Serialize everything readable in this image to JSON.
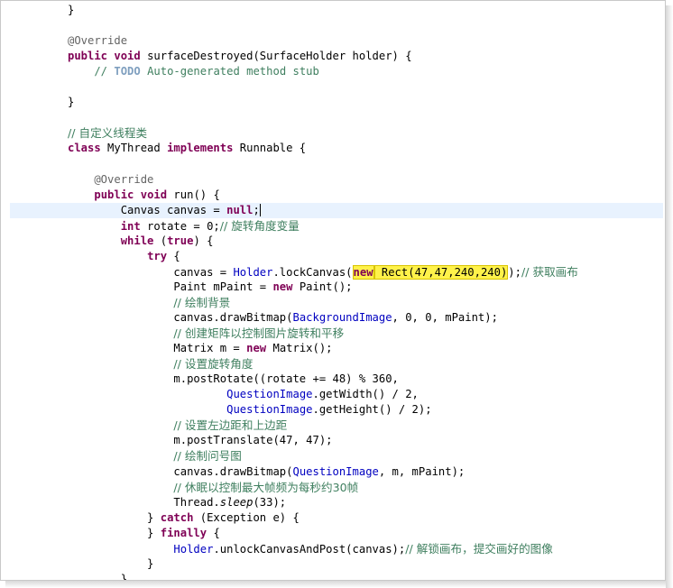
{
  "editor": {
    "current_line": 13,
    "lines": [
      [
        {
          "t": "}"
        }
      ],
      [],
      [
        {
          "t": "@Override",
          "c": "ann"
        }
      ],
      [
        {
          "t": "public",
          "c": "kw"
        },
        {
          "t": " "
        },
        {
          "t": "void",
          "c": "kw"
        },
        {
          "t": " surfaceDestroyed(SurfaceHolder holder) {"
        }
      ],
      [
        {
          "t": "    // ",
          "c": "cm-mono"
        },
        {
          "t": "TODO",
          "c": "todo"
        },
        {
          "t": " Auto-generated method stub",
          "c": "cm-mono"
        }
      ],
      [],
      [
        {
          "t": "}"
        }
      ],
      [],
      [
        {
          "t": "// 自定义线程类",
          "c": "cm"
        }
      ],
      [
        {
          "t": "class",
          "c": "kw"
        },
        {
          "t": " MyThread "
        },
        {
          "t": "implements",
          "c": "kw"
        },
        {
          "t": " Runnable {"
        }
      ],
      [],
      [
        {
          "t": "    @Override",
          "c": "ann"
        }
      ],
      [
        {
          "t": "    "
        },
        {
          "t": "public",
          "c": "kw"
        },
        {
          "t": " "
        },
        {
          "t": "void",
          "c": "kw"
        },
        {
          "t": " run() {"
        }
      ],
      [
        {
          "t": "        Canvas canvas = "
        },
        {
          "t": "null",
          "c": "kw"
        },
        {
          "t": ";"
        },
        {
          "caret": true
        }
      ],
      [
        {
          "t": "        "
        },
        {
          "t": "int",
          "c": "kw"
        },
        {
          "t": " rotate = 0;"
        },
        {
          "t": "// 旋转角度变量",
          "c": "cm"
        }
      ],
      [
        {
          "t": "        "
        },
        {
          "t": "while",
          "c": "kw"
        },
        {
          "t": " ("
        },
        {
          "t": "true",
          "c": "kw"
        },
        {
          "t": ") {"
        }
      ],
      [
        {
          "t": "            "
        },
        {
          "t": "try",
          "c": "kw"
        },
        {
          "t": " {"
        }
      ],
      [
        {
          "t": "                canvas = "
        },
        {
          "t": "Holder",
          "c": "fld"
        },
        {
          "t": ".lockCanvas("
        },
        {
          "t": "new",
          "c": "kw",
          "hl": true
        },
        {
          "t": " Rect(47,47,240,240)",
          "hl": true
        },
        {
          "t": ");"
        },
        {
          "t": "// 获取画布",
          "c": "cm"
        }
      ],
      [
        {
          "t": "                Paint mPaint = "
        },
        {
          "t": "new",
          "c": "kw"
        },
        {
          "t": " Paint();"
        }
      ],
      [
        {
          "t": "                "
        },
        {
          "t": "// 绘制背景",
          "c": "cm"
        }
      ],
      [
        {
          "t": "                canvas.drawBitmap("
        },
        {
          "t": "BackgroundImage",
          "c": "fld"
        },
        {
          "t": ", 0, 0, mPaint);"
        }
      ],
      [
        {
          "t": "                "
        },
        {
          "t": "// 创建矩阵以控制图片旋转和平移",
          "c": "cm"
        }
      ],
      [
        {
          "t": "                Matrix m = "
        },
        {
          "t": "new",
          "c": "kw"
        },
        {
          "t": " Matrix();"
        }
      ],
      [
        {
          "t": "                "
        },
        {
          "t": "// 设置旋转角度",
          "c": "cm"
        }
      ],
      [
        {
          "t": "                m.postRotate((rotate += 48) % 360,"
        }
      ],
      [
        {
          "t": "                        "
        },
        {
          "t": "QuestionImage",
          "c": "fld"
        },
        {
          "t": ".getWidth() / 2,"
        }
      ],
      [
        {
          "t": "                        "
        },
        {
          "t": "QuestionImage",
          "c": "fld"
        },
        {
          "t": ".getHeight() / 2);"
        }
      ],
      [
        {
          "t": "                "
        },
        {
          "t": "// 设置左边距和上边距",
          "c": "cm"
        }
      ],
      [
        {
          "t": "                m.postTranslate(47, 47);"
        }
      ],
      [
        {
          "t": "                "
        },
        {
          "t": "// 绘制问号图",
          "c": "cm"
        }
      ],
      [
        {
          "t": "                canvas.drawBitmap("
        },
        {
          "t": "QuestionImage",
          "c": "fld"
        },
        {
          "t": ", m, mPaint);"
        }
      ],
      [
        {
          "t": "                "
        },
        {
          "t": "// 休眠以控制最大帧频为每秒约30帧",
          "c": "cm"
        }
      ],
      [
        {
          "t": "                Thread."
        },
        {
          "t": "sleep",
          "c": "it"
        },
        {
          "t": "(33);"
        }
      ],
      [
        {
          "t": "            } "
        },
        {
          "t": "catch",
          "c": "kw"
        },
        {
          "t": " (Exception e) {"
        }
      ],
      [
        {
          "t": "            } "
        },
        {
          "t": "finally",
          "c": "kw"
        },
        {
          "t": " {"
        }
      ],
      [
        {
          "t": "                "
        },
        {
          "t": "Holder",
          "c": "fld"
        },
        {
          "t": ".unlockCanvasAndPost(canvas);"
        },
        {
          "t": "// 解锁画布，提交画好的图像",
          "c": "cm"
        }
      ],
      [
        {
          "t": "            }"
        }
      ],
      [
        {
          "t": "        }"
        }
      ]
    ]
  },
  "colors": {
    "keyword": "#7f0055",
    "comment": "#3f7f5f",
    "annotation": "#646464",
    "field": "#0000c0",
    "todo": "#7f9fbf",
    "highlight": "#fff24a",
    "current_line": "#e8f2fe"
  }
}
